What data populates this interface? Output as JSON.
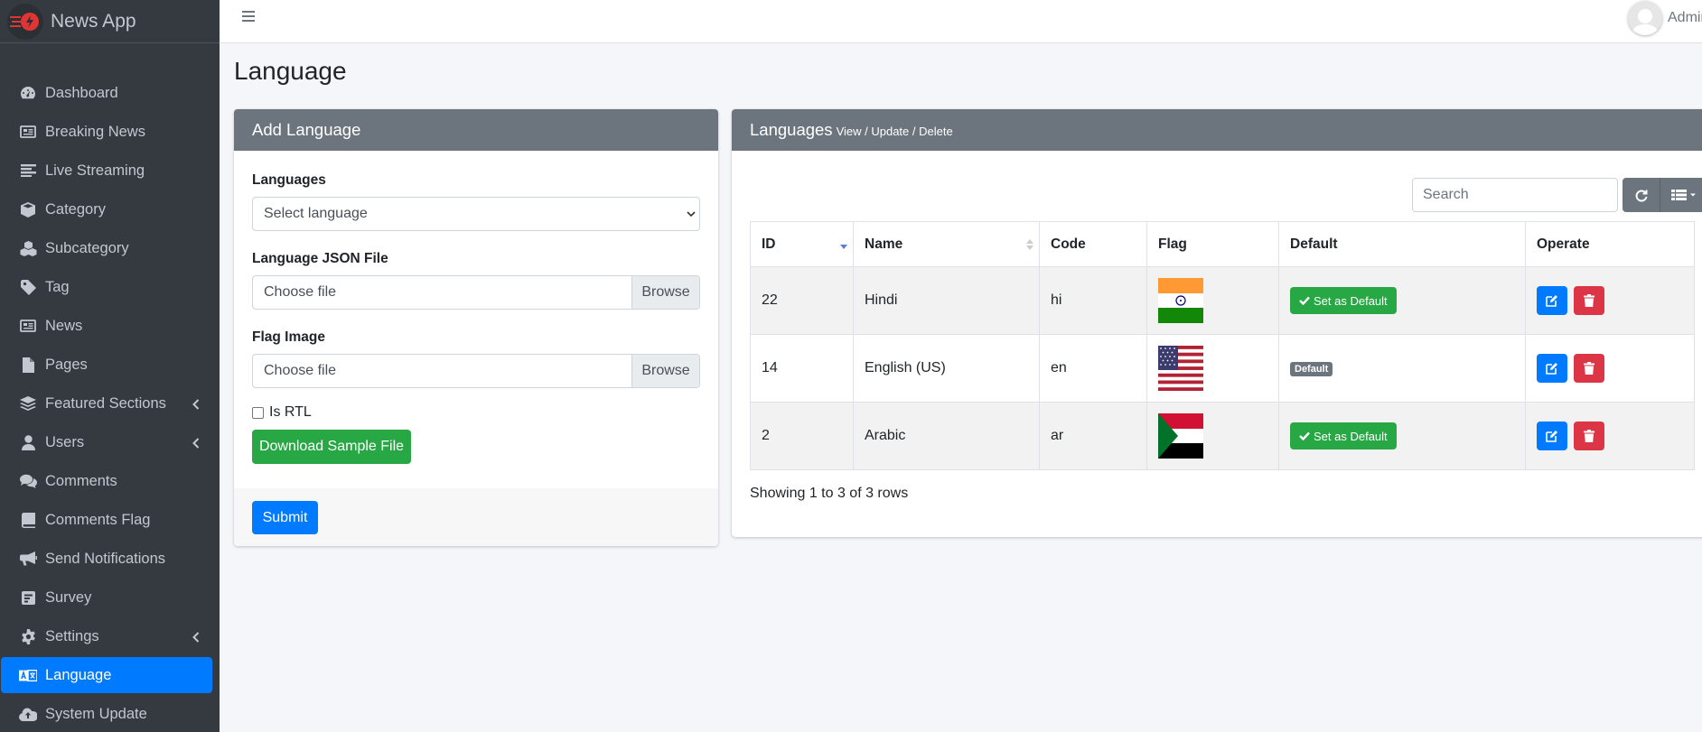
{
  "app": {
    "brand": "News App"
  },
  "sidebar": {
    "items": [
      {
        "label": "Dashboard",
        "icon": "dashboard-icon"
      },
      {
        "label": "Breaking News",
        "icon": "newspaper-icon"
      },
      {
        "label": "Live Streaming",
        "icon": "list-icon"
      },
      {
        "label": "Category",
        "icon": "cube-icon"
      },
      {
        "label": "Subcategory",
        "icon": "cubes-icon"
      },
      {
        "label": "Tag",
        "icon": "tag-icon"
      },
      {
        "label": "News",
        "icon": "newspaper-icon"
      },
      {
        "label": "Pages",
        "icon": "file-icon"
      },
      {
        "label": "Featured Sections",
        "icon": "layers-icon",
        "expandable": true
      },
      {
        "label": "Users",
        "icon": "user-icon",
        "expandable": true
      },
      {
        "label": "Comments",
        "icon": "comments-icon"
      },
      {
        "label": "Comments Flag",
        "icon": "book-icon"
      },
      {
        "label": "Send Notifications",
        "icon": "megaphone-icon"
      },
      {
        "label": "Survey",
        "icon": "poll-icon"
      },
      {
        "label": "Settings",
        "icon": "gear-icon",
        "expandable": true
      },
      {
        "label": "Language",
        "icon": "language-icon",
        "active": true
      },
      {
        "label": "System Update",
        "icon": "cloud-upload-icon"
      }
    ]
  },
  "header": {
    "user_name": "Admin"
  },
  "page": {
    "title": "Language"
  },
  "add_form": {
    "title": "Add Language",
    "languages_label": "Languages",
    "languages_selected": "Select language",
    "json_label": "Language JSON File",
    "json_value": "Choose file",
    "flag_label": "Flag Image",
    "flag_value": "Choose file",
    "browse_label": "Browse",
    "rtl_label": "Is RTL",
    "download_label": "Download Sample File",
    "submit_label": "Submit"
  },
  "list": {
    "title": "Languages",
    "subtitle": "View / Update / Delete",
    "search_placeholder": "Search",
    "columns": [
      "ID",
      "Name",
      "Code",
      "Flag",
      "Default",
      "Operate"
    ],
    "rows": [
      {
        "id": "22",
        "name": "Hindi",
        "code": "hi",
        "flag": "india",
        "default": "Set as Default",
        "is_default": false
      },
      {
        "id": "14",
        "name": "English (US)",
        "code": "en",
        "flag": "usa",
        "default": "Default",
        "is_default": true
      },
      {
        "id": "2",
        "name": "Arabic",
        "code": "ar",
        "flag": "sudan",
        "default": "Set as Default",
        "is_default": false
      }
    ],
    "footer": "Showing 1 to 3 of 3 rows"
  },
  "colors": {
    "sidebar_bg": "#343a40",
    "primary": "#007bff",
    "success": "#28a745",
    "danger": "#dc3545",
    "card_header": "#6c757d"
  }
}
